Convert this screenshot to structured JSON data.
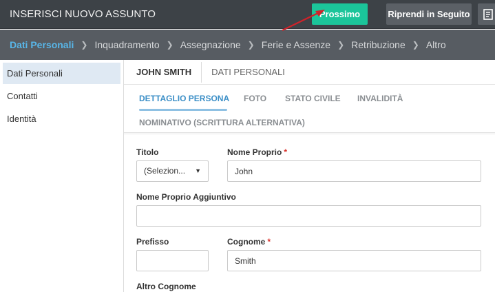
{
  "header": {
    "title": "INSERISCI NUOVO ASSUNTO",
    "next_label": "Prossimo",
    "later_label": "Riprendi in Seguito",
    "doc_icon": "document-icon"
  },
  "steps": [
    {
      "label": "Dati Personali",
      "active": true
    },
    {
      "label": "Inquadramento"
    },
    {
      "label": "Assegnazione"
    },
    {
      "label": "Ferie e Assenze"
    },
    {
      "label": "Retribuzione"
    },
    {
      "label": "Altro"
    }
  ],
  "sidebar": {
    "items": [
      {
        "label": "Dati Personali",
        "active": true
      },
      {
        "label": "Contatti"
      },
      {
        "label": "Identità"
      }
    ]
  },
  "panel": {
    "person_name": "JOHN SMITH",
    "section_title": "DATI PERSONALI",
    "subtabs": [
      {
        "label": "DETTAGLIO PERSONA",
        "active": true
      },
      {
        "label": "FOTO"
      },
      {
        "label": "STATO CIVILE"
      },
      {
        "label": "INVALIDITÀ"
      },
      {
        "label": "NOMINATIVO (SCRITTURA ALTERNATIVA)"
      }
    ]
  },
  "form": {
    "titolo_label": "Titolo",
    "titolo_value": "(Selezion...",
    "nome_label": "Nome Proprio",
    "nome_value": "John",
    "nome_agg_label": "Nome Proprio Aggiuntivo",
    "nome_agg_value": "",
    "prefisso_label": "Prefisso",
    "prefisso_value": "",
    "cognome_label": "Cognome",
    "cognome_value": "Smith",
    "altro_cognome_label": "Altro Cognome",
    "required_mark": "*"
  },
  "colors": {
    "accent_green": "#1bc59a",
    "active_step": "#58b6e8",
    "annotation_arrow": "#d0222a"
  }
}
